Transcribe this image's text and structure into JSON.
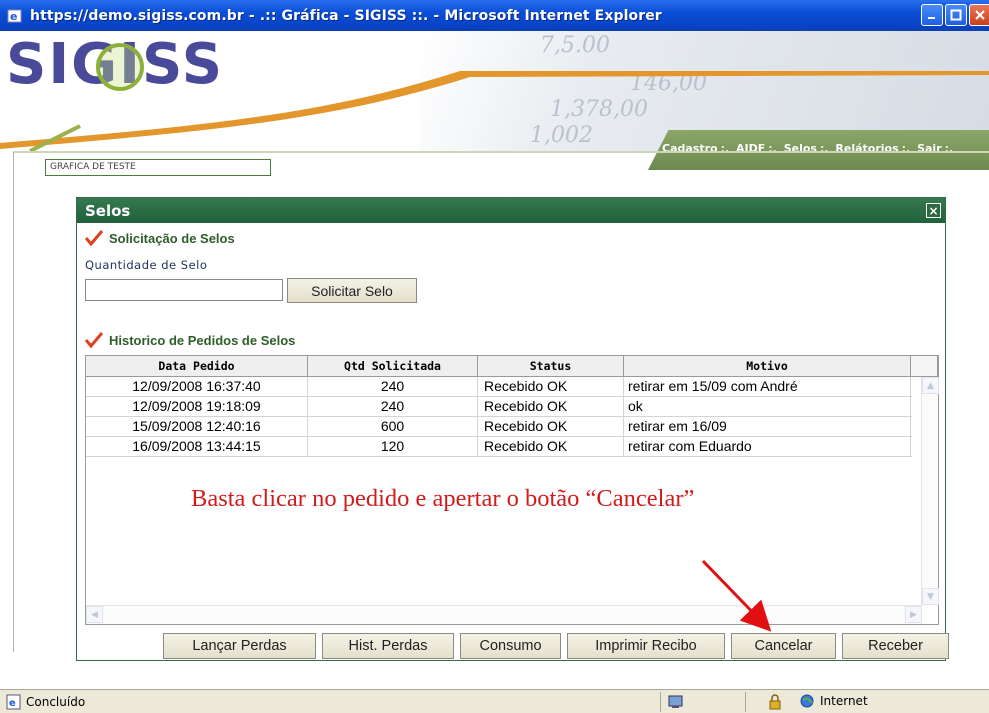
{
  "window": {
    "title": "https://demo.sigiss.com.br - .:: Gráfica - SIGISS ::. - Microsoft Internet Explorer"
  },
  "header": {
    "logo": "SIGISS",
    "banner_digits": [
      "7,5.00",
      "146,00",
      "1,378,00",
      "1,002"
    ],
    "company": "GRAFICA DE TESTE",
    "nav": {
      "cadastro": "Cadastro",
      "aidf": "AIDF",
      "selos": "Selos",
      "relatorios": "Relátorios",
      "sair": "Sair",
      "sep": ":."
    }
  },
  "dialog": {
    "title": "Selos",
    "close_label": "×",
    "section1_title": "Solicitação de Selos",
    "qty_label": "Quantidade de Selo",
    "qty_value": "",
    "solicitar_label": "Solicitar Selo",
    "section2_title": "Historico de Pedidos de Selos",
    "grid": {
      "columns": [
        "Data Pedido",
        "Qtd Solicitada",
        "Status",
        "Motivo"
      ],
      "rows": [
        {
          "date": "12/09/2008 16:37:40",
          "qty": "240",
          "status": "Recebido OK",
          "motivo": "retirar em 15/09 com André"
        },
        {
          "date": "12/09/2008 19:18:09",
          "qty": "240",
          "status": "Recebido OK",
          "motivo": "ok"
        },
        {
          "date": "15/09/2008 12:40:16",
          "qty": "600",
          "status": "Recebido OK",
          "motivo": "retirar em 16/09"
        },
        {
          "date": "16/09/2008 13:44:15",
          "qty": "120",
          "status": "Recebido OK",
          "motivo": "retirar com Eduardo"
        }
      ]
    },
    "annotation": "Basta clicar no pedido e apertar o botão “Cancelar”",
    "buttons": {
      "lancar_perdas": "Lançar Perdas",
      "hist_perdas": "Hist. Perdas",
      "consumo": "Consumo",
      "imprimir_recibo": "Imprimir Recibo",
      "cancelar": "Cancelar",
      "receber": "Receber"
    }
  },
  "statusbar": {
    "status": "Concluído",
    "zone": "Internet"
  },
  "colors": {
    "titlebar": "#0a4fd8",
    "dialog_header": "#2b6a43",
    "section_title": "#2e5d2a",
    "annotation": "#d21b1b",
    "nav_bar": "#7b9658"
  }
}
